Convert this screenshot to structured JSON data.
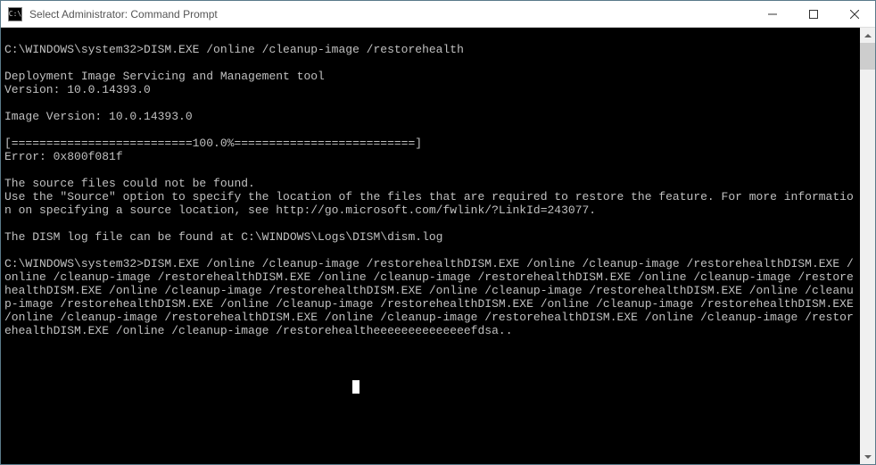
{
  "window": {
    "title": "Select Administrator: Command Prompt",
    "icon_label": "C:\\"
  },
  "terminal": {
    "lines": [
      "",
      "C:\\WINDOWS\\system32>DISM.EXE /online /cleanup-image /restorehealth",
      "",
      "Deployment Image Servicing and Management tool",
      "Version: 10.0.14393.0",
      "",
      "Image Version: 10.0.14393.0",
      "",
      "[==========================100.0%==========================]",
      "Error: 0x800f081f",
      "",
      "The source files could not be found.",
      "Use the \"Source\" option to specify the location of the files that are required to restore the feature. For more information on specifying a source location, see http://go.microsoft.com/fwlink/?LinkId=243077.",
      "",
      "The DISM log file can be found at C:\\WINDOWS\\Logs\\DISM\\dism.log",
      "",
      "C:\\WINDOWS\\system32>DISM.EXE /online /cleanup-image /restorehealthDISM.EXE /online /cleanup-image /restorehealthDISM.EXE /online /cleanup-image /restorehealthDISM.EXE /online /cleanup-image /restorehealthDISM.EXE /online /cleanup-image /restorehealthDISM.EXE /online /cleanup-image /restorehealthDISM.EXE /online /cleanup-image /restorehealthDISM.EXE /online /cleanup-image /restorehealthDISM.EXE /online /cleanup-image /restorehealthDISM.EXE /online /cleanup-image /restorehealthDISM.EXE /online /cleanup-image /restorehealthDISM.EXE /online /cleanup-image /restorehealthDISM.EXE /online /cleanup-image /restorehealthDISM.EXE /online /cleanup-image /restorehealtheeeeeeeeeeeeeefdsa.."
    ]
  }
}
